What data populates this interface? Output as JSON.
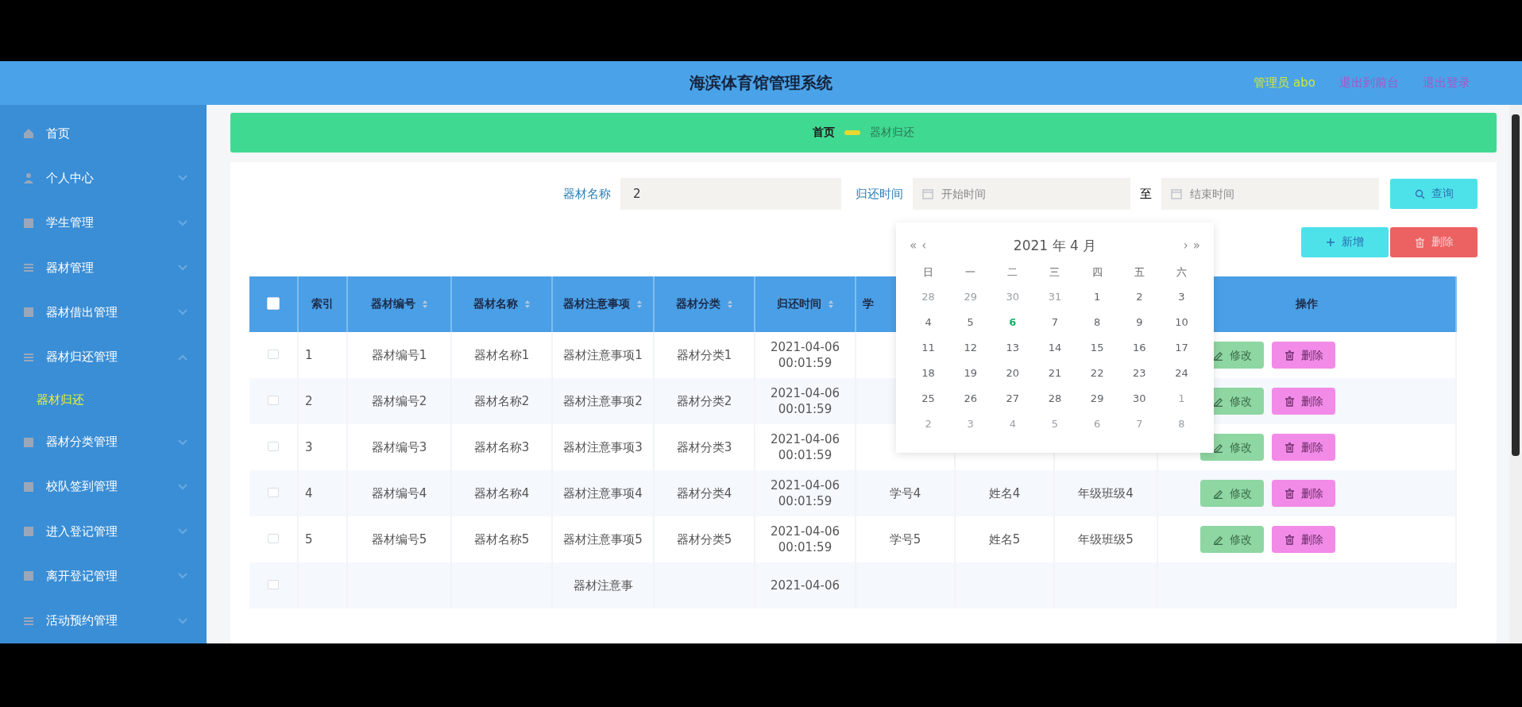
{
  "header": {
    "title": "海滨体育馆管理系统",
    "user": "管理员 abo",
    "links": [
      "退出到前台",
      "退出登录"
    ]
  },
  "sidebar": {
    "items": [
      {
        "label": "首页",
        "selected": false
      },
      {
        "label": "个人中心",
        "selected": false,
        "expanded": false
      },
      {
        "label": "学生管理",
        "selected": false,
        "expanded": false
      },
      {
        "label": "器材管理",
        "selected": false,
        "expanded": false
      },
      {
        "label": "器材借出管理",
        "selected": false,
        "expanded": false
      },
      {
        "label": "器材归还管理",
        "selected": false,
        "expanded": true,
        "children": [
          {
            "label": "器材归还",
            "selected": true
          }
        ]
      },
      {
        "label": "器材分类管理",
        "selected": false,
        "expanded": false
      },
      {
        "label": "校队签到管理",
        "selected": false,
        "expanded": false
      },
      {
        "label": "进入登记管理",
        "selected": false,
        "expanded": false
      },
      {
        "label": "离开登记管理",
        "selected": false,
        "expanded": false
      },
      {
        "label": "活动预约管理",
        "selected": false,
        "expanded": false
      }
    ]
  },
  "breadcrumb": [
    {
      "label": "首页",
      "current": false
    },
    {
      "label": "器材归还",
      "current": true
    }
  ],
  "search": {
    "name_label": "器材名称",
    "name_value": "2",
    "time_label": "归还时间",
    "start_placeholder": "开始时间",
    "separator": "至",
    "end_placeholder": "结束时间",
    "search_button": "查询"
  },
  "actions": [
    {
      "label": "新增",
      "kind": "add"
    },
    {
      "label": "删除",
      "kind": "delete"
    }
  ],
  "table": {
    "header_checked": false,
    "columns": [
      {
        "label": "索引",
        "sortable": false
      },
      {
        "label": "器材编号",
        "sortable": true
      },
      {
        "label": "器材名称",
        "sortable": true
      },
      {
        "label": "器材注意事项",
        "sortable": true
      },
      {
        "label": "器材分类",
        "sortable": true
      },
      {
        "label": "归还时间",
        "sortable": true
      },
      {
        "label": "学",
        "sortable": false
      },
      {},
      {},
      {
        "label": "操作",
        "sortable": false
      }
    ],
    "rows": [
      {
        "checked": false,
        "cells": [
          "1",
          "器材编号1",
          "器材名称1",
          "器材注意事项1",
          "器材分类1",
          "2021-04-06 00:01:59",
          null,
          null,
          null
        ],
        "actions": [
          {
            "label": "修改",
            "kind": "edit"
          },
          {
            "label": "删除",
            "kind": "delete"
          }
        ]
      },
      {
        "checked": false,
        "cells": [
          "2",
          "器材编号2",
          "器材名称2",
          "器材注意事项2",
          "器材分类2",
          "2021-04-06 00:01:59",
          null,
          null,
          null
        ],
        "actions": [
          {
            "label": "修改",
            "kind": "edit"
          },
          {
            "label": "删除",
            "kind": "delete"
          }
        ]
      },
      {
        "checked": false,
        "cells": [
          "3",
          "器材编号3",
          "器材名称3",
          "器材注意事项3",
          "器材分类3",
          "2021-04-06 00:01:59",
          null,
          null,
          null
        ],
        "actions": [
          {
            "label": "修改",
            "kind": "edit"
          },
          {
            "label": "删除",
            "kind": "delete"
          }
        ]
      },
      {
        "checked": false,
        "cells": [
          "4",
          "器材编号4",
          "器材名称4",
          "器材注意事项4",
          "器材分类4",
          "2021-04-06 00:01:59",
          "学号4",
          "姓名4",
          "年级班级4"
        ],
        "actions": [
          {
            "label": "修改",
            "kind": "edit"
          },
          {
            "label": "删除",
            "kind": "delete"
          }
        ]
      },
      {
        "checked": false,
        "cells": [
          "5",
          "器材编号5",
          "器材名称5",
          "器材注意事项5",
          "器材分类5",
          "2021-04-06 00:01:59",
          "学号5",
          "姓名5",
          "年级班级5"
        ],
        "actions": [
          {
            "label": "修改",
            "kind": "edit"
          },
          {
            "label": "删除",
            "kind": "delete"
          }
        ]
      },
      {
        "checked": false,
        "cells": [
          null,
          null,
          null,
          "器材注意事",
          null,
          "2021-04-06",
          null,
          null,
          null
        ]
      }
    ]
  },
  "calendar": {
    "title": "2021 年 4 月",
    "prev_year": "«",
    "prev_month": "‹",
    "next_month": "›",
    "next_year": "»",
    "weekdays": [
      "日",
      "一",
      "二",
      "三",
      "四",
      "五",
      "六"
    ],
    "days": [
      {
        "label": "28",
        "in_month": false,
        "selected": false
      },
      {
        "label": "29",
        "in_month": false,
        "selected": false
      },
      {
        "label": "30",
        "in_month": false,
        "selected": false
      },
      {
        "label": "31",
        "in_month": false,
        "selected": false
      },
      {
        "label": "1",
        "in_month": true,
        "selected": false
      },
      {
        "label": "2",
        "in_month": true,
        "selected": false
      },
      {
        "label": "3",
        "in_month": true,
        "selected": false
      },
      {
        "label": "4",
        "in_month": true,
        "selected": false
      },
      {
        "label": "5",
        "in_month": true,
        "selected": false
      },
      {
        "label": "6",
        "in_month": true,
        "selected": true
      },
      {
        "label": "7",
        "in_month": true,
        "selected": false
      },
      {
        "label": "8",
        "in_month": true,
        "selected": false
      },
      {
        "label": "9",
        "in_month": true,
        "selected": false
      },
      {
        "label": "10",
        "in_month": true,
        "selected": false
      },
      {
        "label": "11",
        "in_month": true,
        "selected": false
      },
      {
        "label": "12",
        "in_month": true,
        "selected": false
      },
      {
        "label": "13",
        "in_month": true,
        "selected": false
      },
      {
        "label": "14",
        "in_month": true,
        "selected": false
      },
      {
        "label": "15",
        "in_month": true,
        "selected": false
      },
      {
        "label": "16",
        "in_month": true,
        "selected": false
      },
      {
        "label": "17",
        "in_month": true,
        "selected": false
      },
      {
        "label": "18",
        "in_month": true,
        "selected": false
      },
      {
        "label": "19",
        "in_month": true,
        "selected": false
      },
      {
        "label": "20",
        "in_month": true,
        "selected": false
      },
      {
        "label": "21",
        "in_month": true,
        "selected": false
      },
      {
        "label": "22",
        "in_month": true,
        "selected": false
      },
      {
        "label": "23",
        "in_month": true,
        "selected": false
      },
      {
        "label": "24",
        "in_month": true,
        "selected": false
      },
      {
        "label": "25",
        "in_month": true,
        "selected": false
      },
      {
        "label": "26",
        "in_month": true,
        "selected": false
      },
      {
        "label": "27",
        "in_month": true,
        "selected": false
      },
      {
        "label": "28",
        "in_month": true,
        "selected": false
      },
      {
        "label": "29",
        "in_month": true,
        "selected": false
      },
      {
        "label": "30",
        "in_month": true,
        "selected": false
      },
      {
        "label": "1",
        "in_month": false,
        "selected": false
      },
      {
        "label": "2",
        "in_month": false,
        "selected": false
      },
      {
        "label": "3",
        "in_month": false,
        "selected": false
      },
      {
        "label": "4",
        "in_month": false,
        "selected": false
      },
      {
        "label": "5",
        "in_month": false,
        "selected": false
      },
      {
        "label": "6",
        "in_month": false,
        "selected": false
      },
      {
        "label": "7",
        "in_month": false,
        "selected": false
      },
      {
        "label": "8",
        "in_month": false,
        "selected": false
      }
    ]
  }
}
